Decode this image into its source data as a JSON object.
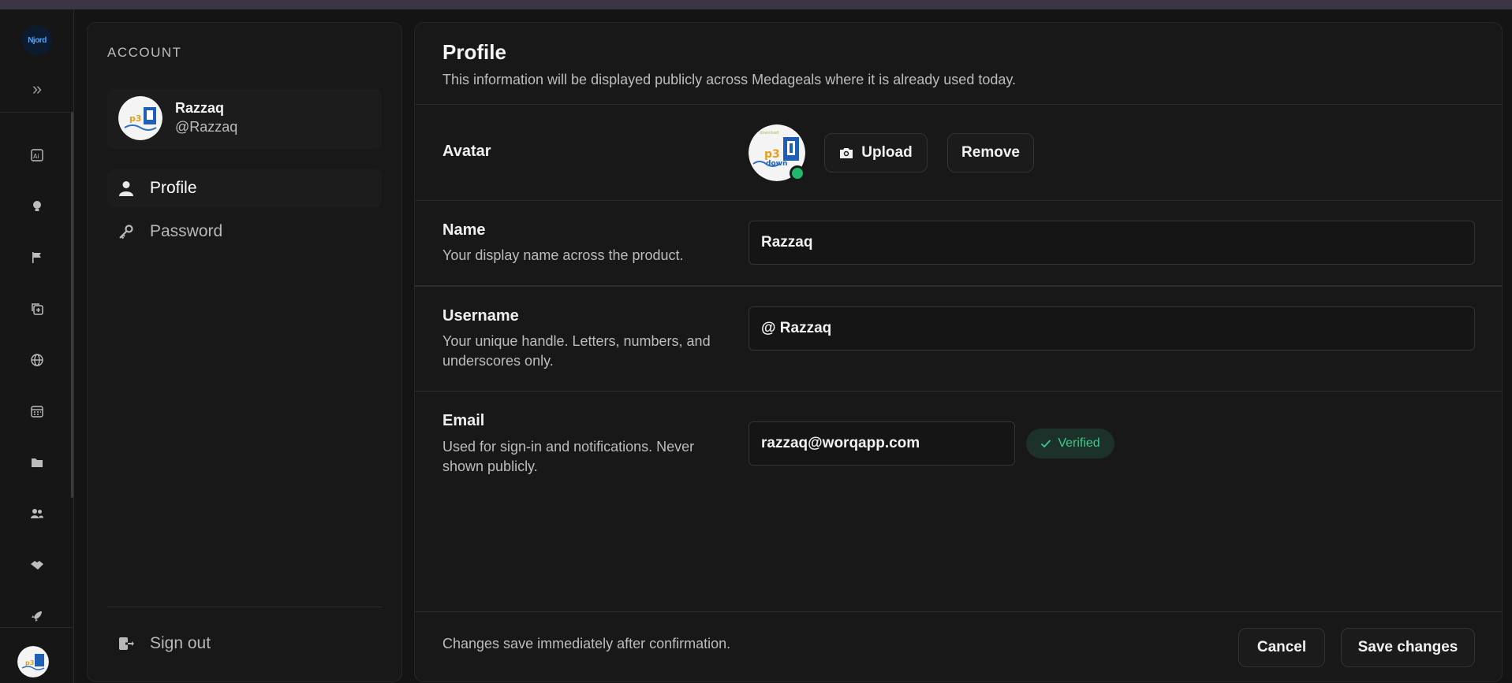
{
  "rail": {
    "logo_text": "Njord",
    "icons": [
      "ai-icon",
      "lightbulb-icon",
      "flag-icon",
      "add-copy-icon",
      "globe-icon",
      "calendar-icon",
      "folder-icon",
      "users-icon",
      "handshake-icon",
      "rocket-icon"
    ]
  },
  "account": {
    "heading": "ACCOUNT",
    "user_name": "Razzaq",
    "user_handle": "@Razzaq",
    "nav": [
      {
        "label": "Profile",
        "icon": "user-icon",
        "active": true
      },
      {
        "label": "Password",
        "icon": "key-icon",
        "active": false
      }
    ],
    "sign_out_label": "Sign out"
  },
  "profile": {
    "title": "Profile",
    "subtitle": "This information will be displayed publicly across Medageals where it is already used today.",
    "avatar": {
      "label": "Avatar",
      "upload_label": "Upload",
      "remove_label": "Remove"
    },
    "name": {
      "label": "Name",
      "description": "Your display name across the product.",
      "value": "Razzaq"
    },
    "username": {
      "label": "Username",
      "description": "Your unique handle. Letters, numbers, and underscores only.",
      "value": "@ Razzaq"
    },
    "email": {
      "label": "Email",
      "description": "Used for sign-in and notifications. Never shown publicly.",
      "value": "razzaq@worqapp.com",
      "badge": "Verified"
    },
    "footer": {
      "note": "Changes save immediately after confirmation.",
      "cancel_label": "Cancel",
      "save_label": "Save changes"
    }
  },
  "colors": {
    "background": "#141414",
    "panel": "#181818",
    "accent_green": "#1fb86c",
    "verified_text": "#3cc98a"
  }
}
